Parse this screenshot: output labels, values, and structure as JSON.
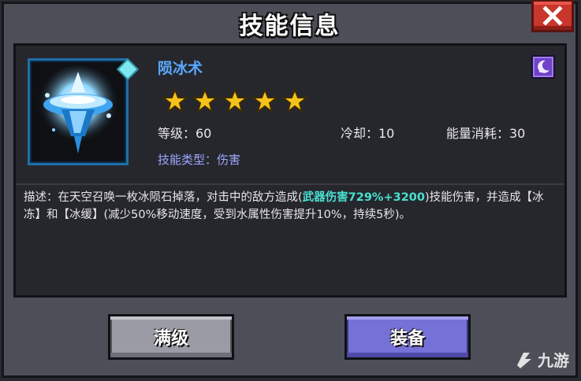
{
  "dialog": {
    "title": "技能信息",
    "close_icon": "close-icon"
  },
  "skill": {
    "name": "陨冰术",
    "stars": 5,
    "level": "等级：60",
    "cooldown": "冷却：10",
    "energy": "能量消耗：30",
    "type": "技能类型：伤害",
    "icon": "ice-meteor-skill-icon",
    "badge_icon": "moon-magic-type-icon"
  },
  "description": {
    "part1": "描述：在天空召唤一枚冰陨石掉落，对击中的敌方造成(",
    "highlight": "武器伤害729%+3200",
    "part2": ")技能伤害，并造成【冰冻】和【冰缓】(减少50%移动速度，受到水属性伤害提升10%，持续5秒)。"
  },
  "buttons": {
    "max_level": "满级",
    "equip": "装备"
  },
  "watermark": {
    "text": "九游"
  },
  "colors": {
    "skill_name": "#5aa8ff",
    "highlight": "#49e0d0",
    "star": "#f5c21b",
    "equip_button": "#7671d6",
    "max_button": "#9a9ba4",
    "close_button": "#c9362c"
  }
}
